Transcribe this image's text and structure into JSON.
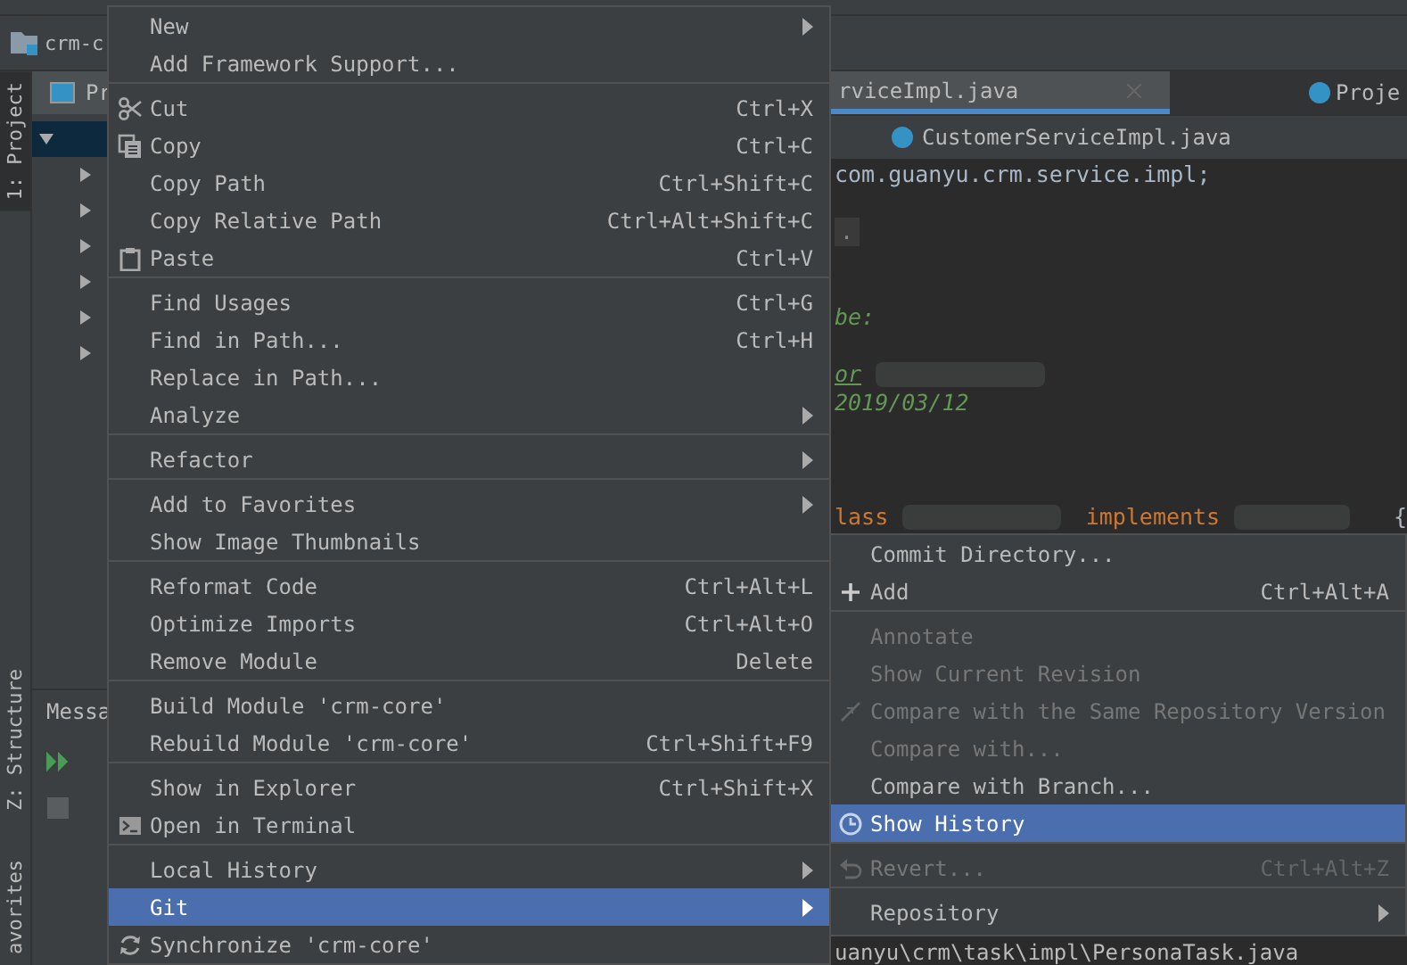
{
  "ide": {
    "project_title": "crm-c",
    "stripe_tabs": [
      {
        "label": "1: Project",
        "selected": true
      },
      {
        "label": "Z: Structure",
        "selected": false
      },
      {
        "label": "avorites",
        "selected": false
      }
    ],
    "project_panel": {
      "header": "Pr",
      "tree_nodes": [
        {
          "expanded": true
        },
        {
          "expanded": false
        },
        {
          "expanded": false
        },
        {
          "expanded": false
        },
        {
          "expanded": false
        },
        {
          "expanded": false
        },
        {
          "expanded": false
        }
      ]
    },
    "messages_tab": "Messa",
    "editor": {
      "tabs": [
        {
          "label": "rviceImpl.java",
          "selected": true
        },
        {
          "label": "Proje",
          "selected": false
        }
      ],
      "breadcrumb": "CustomerServiceImpl.java",
      "code_lines": [
        {
          "tokens": [
            {
              "kind": "plain",
              "text": "com.guanyu.crm.service.impl;"
            }
          ]
        },
        {
          "kind": "blank"
        },
        {
          "tokens": [
            {
              "kind": "fold",
              "text": "."
            }
          ]
        },
        {
          "kind": "blank"
        },
        {
          "kind": "blank"
        },
        {
          "tokens": [
            {
              "kind": "comment",
              "text": "be:"
            }
          ]
        },
        {
          "kind": "blank"
        },
        {
          "tokens": [
            {
              "kind": "tag",
              "text": "or"
            },
            {
              "kind": "redacted"
            }
          ]
        },
        {
          "tokens": [
            {
              "kind": "comment",
              "text": "2019/03/12"
            }
          ]
        },
        {
          "kind": "blank"
        },
        {
          "kind": "blank"
        },
        {
          "kind": "blank"
        },
        {
          "tokens": [
            {
              "kind": "keyword",
              "text": "lass"
            },
            {
              "kind": "redacted"
            },
            {
              "kind": "keyword",
              "text": "implements"
            },
            {
              "kind": "redacted"
            },
            {
              "kind": "plain",
              "text": "{"
            }
          ]
        }
      ],
      "status_path": "uanyu\\crm\\task\\impl\\PersonaTask.java"
    }
  },
  "context_menu": {
    "sections": [
      {
        "items": [
          {
            "label": "New",
            "submenu": true,
            "selected": false,
            "disabled": false
          },
          {
            "label": "Add Framework Support...",
            "selected": false,
            "disabled": false
          }
        ]
      },
      {
        "items": [
          {
            "label": "Cut",
            "shortcut": "Ctrl+X",
            "selected": false,
            "disabled": false
          },
          {
            "label": "Copy",
            "shortcut": "Ctrl+C",
            "selected": false,
            "disabled": false
          },
          {
            "label": "Copy Path",
            "shortcut": "Ctrl+Shift+C",
            "selected": false,
            "disabled": false
          },
          {
            "label": "Copy Relative Path",
            "shortcut": "Ctrl+Alt+Shift+C",
            "selected": false,
            "disabled": false
          },
          {
            "label": "Paste",
            "shortcut": "Ctrl+V",
            "selected": false,
            "disabled": false
          }
        ]
      },
      {
        "items": [
          {
            "label": "Find Usages",
            "shortcut": "Ctrl+G",
            "selected": false,
            "disabled": false
          },
          {
            "label": "Find in Path...",
            "shortcut": "Ctrl+H",
            "selected": false,
            "disabled": false
          },
          {
            "label": "Replace in Path...",
            "selected": false,
            "disabled": false
          },
          {
            "label": "Analyze",
            "submenu": true,
            "selected": false,
            "disabled": false
          }
        ]
      },
      {
        "items": [
          {
            "label": "Refactor",
            "submenu": true,
            "selected": false,
            "disabled": false
          }
        ]
      },
      {
        "items": [
          {
            "label": "Add to Favorites",
            "submenu": true,
            "selected": false,
            "disabled": false
          },
          {
            "label": "Show Image Thumbnails",
            "selected": false,
            "disabled": false
          }
        ]
      },
      {
        "items": [
          {
            "label": "Reformat Code",
            "shortcut": "Ctrl+Alt+L",
            "selected": false,
            "disabled": false
          },
          {
            "label": "Optimize Imports",
            "shortcut": "Ctrl+Alt+O",
            "selected": false,
            "disabled": false
          },
          {
            "label": "Remove Module",
            "shortcut": "Delete",
            "selected": false,
            "disabled": false
          }
        ]
      },
      {
        "items": [
          {
            "label": "Build Module 'crm-core'",
            "selected": false,
            "disabled": false
          },
          {
            "label": "Rebuild Module 'crm-core'",
            "shortcut": "Ctrl+Shift+F9",
            "selected": false,
            "disabled": false
          }
        ]
      },
      {
        "items": [
          {
            "label": "Show in Explorer",
            "shortcut": "Ctrl+Shift+X",
            "selected": false,
            "disabled": false
          },
          {
            "label": "Open in Terminal",
            "selected": false,
            "disabled": false
          }
        ]
      },
      {
        "items": [
          {
            "label": "Local History",
            "submenu": true,
            "selected": false,
            "disabled": false
          },
          {
            "label": "Git",
            "submenu": true,
            "selected": true,
            "disabled": false
          },
          {
            "label": "Synchronize 'crm-core'",
            "selected": false,
            "disabled": false
          }
        ]
      }
    ]
  },
  "git_submenu": {
    "sections": [
      {
        "items": [
          {
            "label": "Commit Directory...",
            "selected": false,
            "disabled": false
          },
          {
            "label": "Add",
            "shortcut": "Ctrl+Alt+A",
            "selected": false,
            "disabled": false
          }
        ]
      },
      {
        "items": [
          {
            "label": "Annotate",
            "selected": false,
            "disabled": true
          },
          {
            "label": "Show Current Revision",
            "selected": false,
            "disabled": true
          },
          {
            "label": "Compare with the Same Repository Version",
            "selected": false,
            "disabled": true
          },
          {
            "label": "Compare with...",
            "selected": false,
            "disabled": true
          },
          {
            "label": "Compare with Branch...",
            "selected": false,
            "disabled": false
          },
          {
            "label": "Show History",
            "selected": true,
            "disabled": false
          }
        ]
      },
      {
        "items": [
          {
            "label": "Revert...",
            "shortcut": "Ctrl+Alt+Z",
            "selected": false,
            "disabled": true
          }
        ]
      },
      {
        "items": [
          {
            "label": "Repository",
            "submenu": true,
            "selected": false,
            "disabled": false
          }
        ]
      }
    ]
  }
}
